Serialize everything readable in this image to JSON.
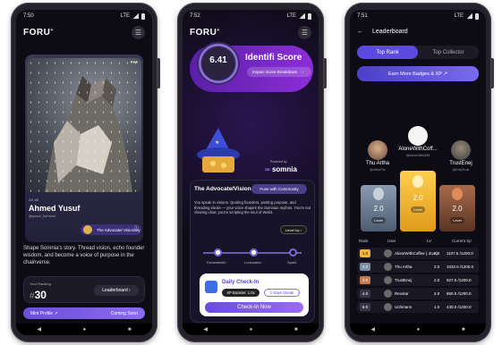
{
  "p1": {
    "status_time": "7:50",
    "status_net": "LTE",
    "logo": "FORU",
    "menu_icon": "☰",
    "card_tag": "AS #8",
    "name": "Ahmed Yusuf",
    "handle": "@yusuf_forhimm",
    "role": "The Advocate/ Visionary",
    "blurb": "Shape Somnia's story. Thread vision, echo founder wisdom, and become a voice of purpose in the chainverse.",
    "rank_label": "Your Ranking",
    "rank_num": "30",
    "rank_hash": "#",
    "leaderboard_btn": "Leaderboard",
    "mint_label": "Mint Profile ↗",
    "mint_status": "Coming Soon"
  },
  "p2": {
    "status_time": "7:52",
    "status_net": "LTE",
    "logo": "FORU",
    "score": "6.41",
    "score_title": "Identifi Score",
    "score_pill": "Impact Score Breakdown",
    "powered": "Powered by",
    "somnia": "somnia",
    "adv_title": "The Advocate/Vision...",
    "fuse_btn": "Fuse with Community",
    "adv_text": "You speak in visions. Quoting founders, posting purpose, and threading ideals — your voice shapes the Somnian mythos. You're not chasing clout; you're scripting the soul of Web3.",
    "levelup": "Level Up",
    "nodes": [
      "Dreamsmith",
      "Lorecaster",
      "Spark"
    ],
    "checkin_title": "Daily Check-In",
    "booster": "XP Booster: 1.0x",
    "streak": "1-Days Streak",
    "checkin_btn": "Check-In Now"
  },
  "p3": {
    "status_time": "7:51",
    "status_net": "LTE",
    "title": "Leaderboard",
    "tabs": [
      "Top Rank",
      "Top Collector"
    ],
    "earn_btn": "Earn More Badges & XP",
    "podium": [
      {
        "name": "Thu Artha",
        "handle": "@ArthaThu",
        "xp": "2.0",
        "lv": "Level"
      },
      {
        "name": "AloneWithCoff...",
        "handle": "@AloneWithM48",
        "xp": "2.0",
        "lv": "Level"
      },
      {
        "name": "TrustEnej",
        "handle": "@EnejTrust",
        "xp": "2.0",
        "lv": "Level"
      }
    ],
    "table_headers": [
      "Rank",
      "User",
      "LV",
      "Current Xp"
    ],
    "rows": [
      {
        "rank": "1.0",
        "user": "AloneWithCoffee ( 4UA)",
        "lv": "2.0",
        "xp": "1107.5 /1200.0"
      },
      {
        "rank": "2.0",
        "user": "Thu Artha",
        "lv": "2.0",
        "xp": "1032.5 /1200.0"
      },
      {
        "rank": "3.0",
        "user": "TrustEnej",
        "lv": "2.0",
        "xp": "927.5 /1200.0"
      },
      {
        "rank": "4.0",
        "user": "Rexstar",
        "lv": "2.0",
        "xp": "850.0 /1200.0"
      },
      {
        "rank": "5.0",
        "user": "Uchmann",
        "lv": "1.0",
        "xp": "430.0 /1200.0"
      }
    ]
  },
  "colors": {
    "accent": "#6b4fd8",
    "gold": "#f2b632",
    "silver": "#7d8fa3",
    "bronze": "#c77a4b"
  }
}
